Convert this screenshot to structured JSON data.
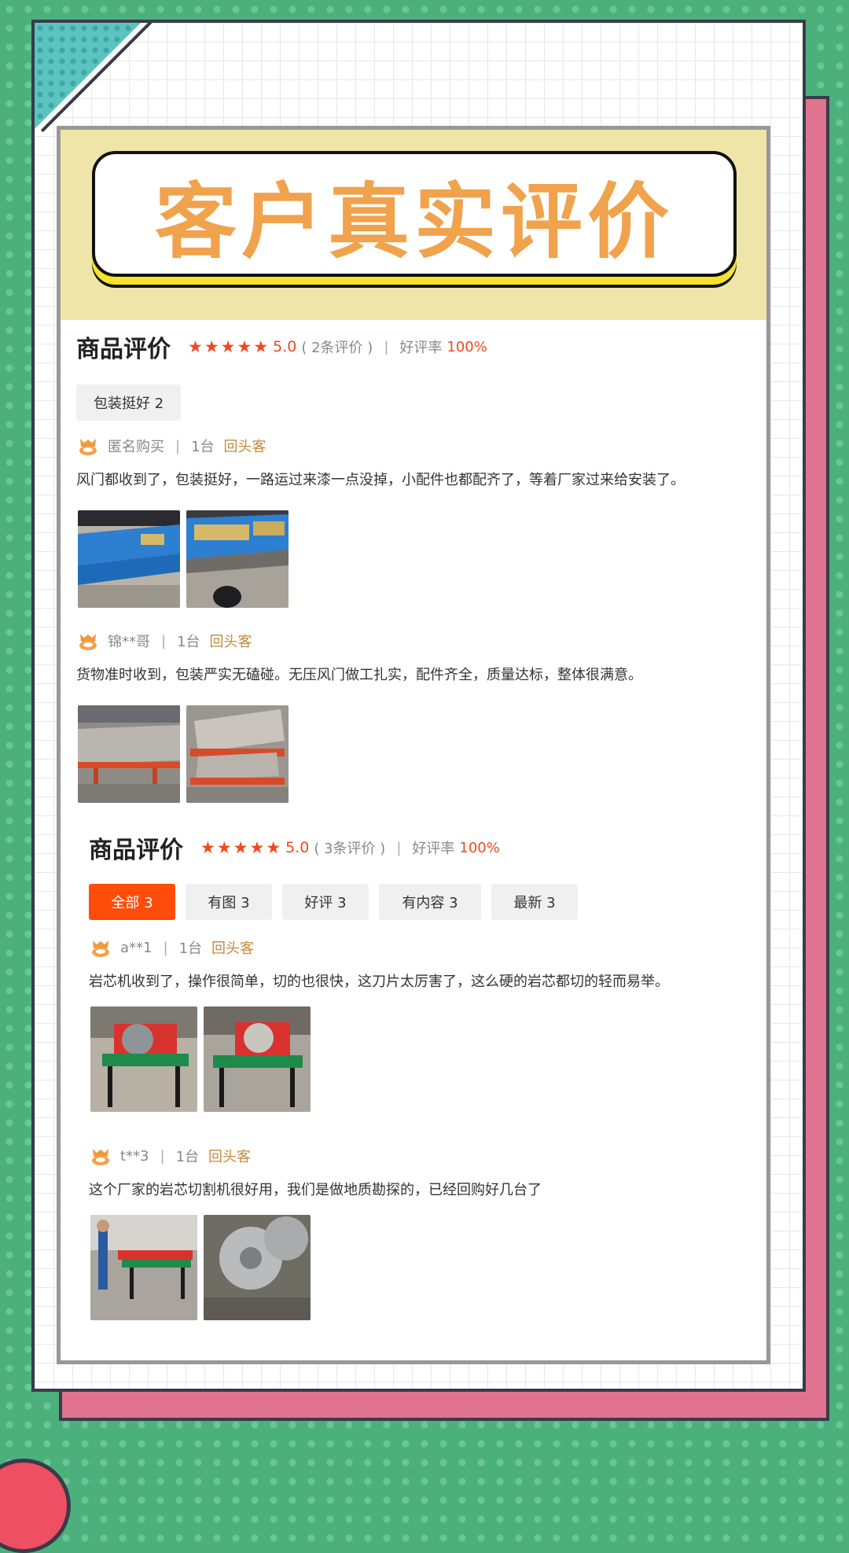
{
  "banner": {
    "title": "客户真实评价"
  },
  "section1": {
    "title": "商品评价",
    "score": "5.0",
    "count_text": "( 2条评价 )",
    "rate_label": "好评率",
    "rate_value": "100%",
    "tags": [
      {
        "label": "包装挺好 2"
      }
    ],
    "reviews": [
      {
        "user": "匿名购买",
        "qty": "1台",
        "badge": "回头客",
        "text": "风门都收到了，包装挺好，一路运过来漆一点没掉，小配件也都配齐了，等着厂家过来给安装了。"
      },
      {
        "user": "锦**哥",
        "qty": "1台",
        "badge": "回头客",
        "text": "货物准时收到，包装严实无磕碰。无压风门做工扎实，配件齐全，质量达标，整体很满意。"
      }
    ]
  },
  "section2": {
    "title": "商品评价",
    "score": "5.0",
    "count_text": "( 3条评价 )",
    "rate_label": "好评率",
    "rate_value": "100%",
    "tabs": [
      {
        "label": "全部 3",
        "active": true
      },
      {
        "label": "有图 3"
      },
      {
        "label": "好评 3"
      },
      {
        "label": "有内容 3"
      },
      {
        "label": "最新 3"
      }
    ],
    "reviews": [
      {
        "user": "a**1",
        "qty": "1台",
        "badge": "回头客",
        "text": "岩芯机收到了，操作很简单，切的也很快，这刀片太厉害了，这么硬的岩芯都切的轻而易举。"
      },
      {
        "user": "t**3",
        "qty": "1台",
        "badge": "回头客",
        "text": "这个厂家的岩芯切割机很好用，我们是做地质勘探的，已经回购好几台了"
      }
    ]
  },
  "separator": "|",
  "colors": {
    "accent": "#ff4c0b",
    "star": "#f0491f",
    "badge": "#c58a3a",
    "title": "#f0a24c",
    "background": "#4cb07c",
    "pink_card": "#e07390"
  }
}
